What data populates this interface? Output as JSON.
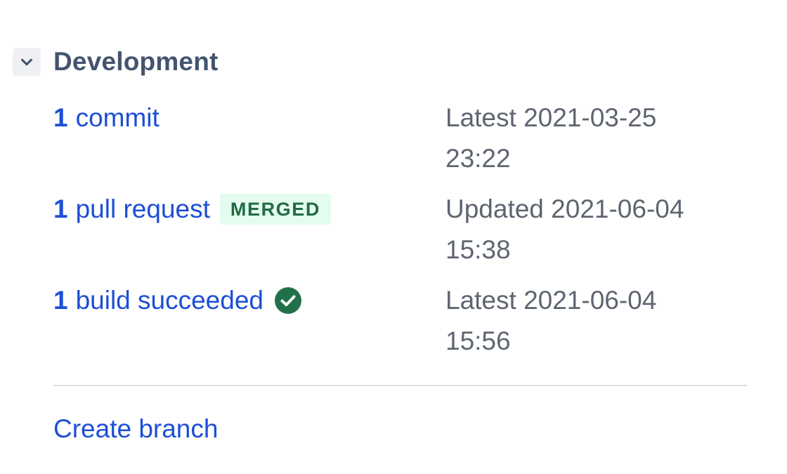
{
  "section": {
    "title": "Development",
    "collapse_icon": "chevron-down-icon"
  },
  "commits": {
    "count": "1",
    "label": "commit",
    "meta_line1": "Latest 2021-03-25",
    "meta_line2": "23:22"
  },
  "pull_requests": {
    "count": "1",
    "label": "pull request",
    "badge": "MERGED",
    "badge_color": "#226b45",
    "badge_bg": "#e3fcef",
    "meta_line1": "Updated 2021-06-04",
    "meta_line2": "15:38"
  },
  "builds": {
    "count": "1",
    "label": "build succeeded",
    "status_icon": "check-circle-icon",
    "status_color": "#22704a",
    "meta_line1": "Latest 2021-06-04",
    "meta_line2": "15:56"
  },
  "actions": {
    "create_branch": "Create branch"
  },
  "colors": {
    "link": "#1d4fd6",
    "title": "#44546f",
    "meta": "#5e6570",
    "divider": "#dcdfe4"
  }
}
